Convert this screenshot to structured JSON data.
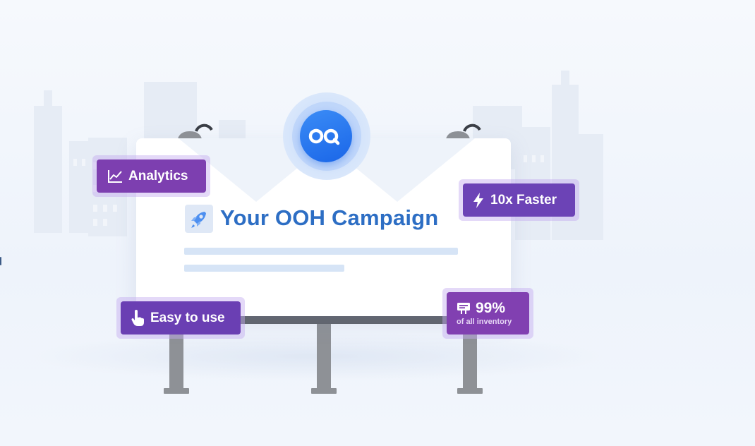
{
  "billboard": {
    "headline": "Your OOH Campaign"
  },
  "badges": {
    "analytics": "Analytics",
    "faster": "10x Faster",
    "easy": "Easy to use",
    "inventory_value": "99%",
    "inventory_caption": "of all inventory"
  },
  "icons": {
    "logo": "brand-logo-icon",
    "headline": "rocket-icon",
    "analytics": "line-chart-icon",
    "faster": "lightning-bolt-icon",
    "easy": "pointer-hand-icon",
    "inventory": "billboard-icon"
  },
  "colors": {
    "headline": "#2d6ec4",
    "logo": "#1a66e8",
    "badge_purple": "#7d3fb0",
    "badge_violet": "#6c43b6",
    "board": "#ffffff",
    "background": "#eef3fb"
  }
}
